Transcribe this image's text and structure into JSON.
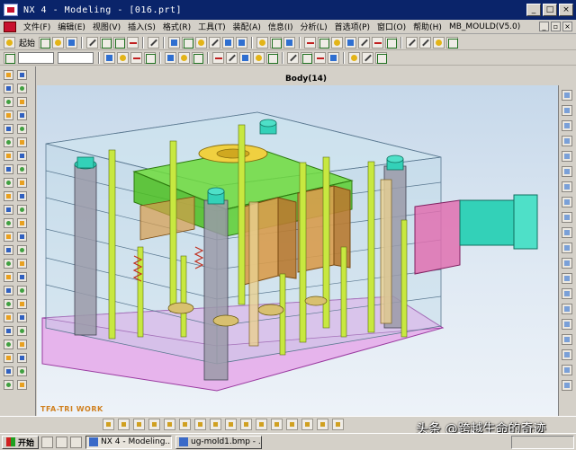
{
  "window": {
    "title": "NX 4 - Modeling - [016.prt]",
    "controls": [
      "_",
      "□",
      "×"
    ]
  },
  "menu": {
    "items": [
      "文件(F)",
      "编辑(E)",
      "视图(V)",
      "插入(S)",
      "格式(R)",
      "工具(T)",
      "装配(A)",
      "信息(I)",
      "分析(L)",
      "首选项(P)",
      "窗口(O)",
      "帮助(H)",
      "MB_MOULD(V5.0)"
    ]
  },
  "toolbar": {
    "start_label": "起始"
  },
  "viewport": {
    "part_label": "Body(14)",
    "logo_text": "TFA-TRI WORK"
  },
  "taskbar": {
    "start_label": "开始",
    "tasks": [
      "NX 4 - Modeling...",
      "ug-mold1.bmp - ..."
    ]
  },
  "overlay": {
    "attribution": "头条 @跨越生命的奇迹"
  },
  "colors": {
    "titlebar": "#0a246a",
    "chrome": "#d4d0c8",
    "viewport_top": "#c6d8ea",
    "mold_green": "#6fdc3c",
    "cylinder_cyan": "#33d1b8",
    "ejector_plate_magenta": "#e6a0e8",
    "mold_block_orange": "#d89c4c"
  }
}
